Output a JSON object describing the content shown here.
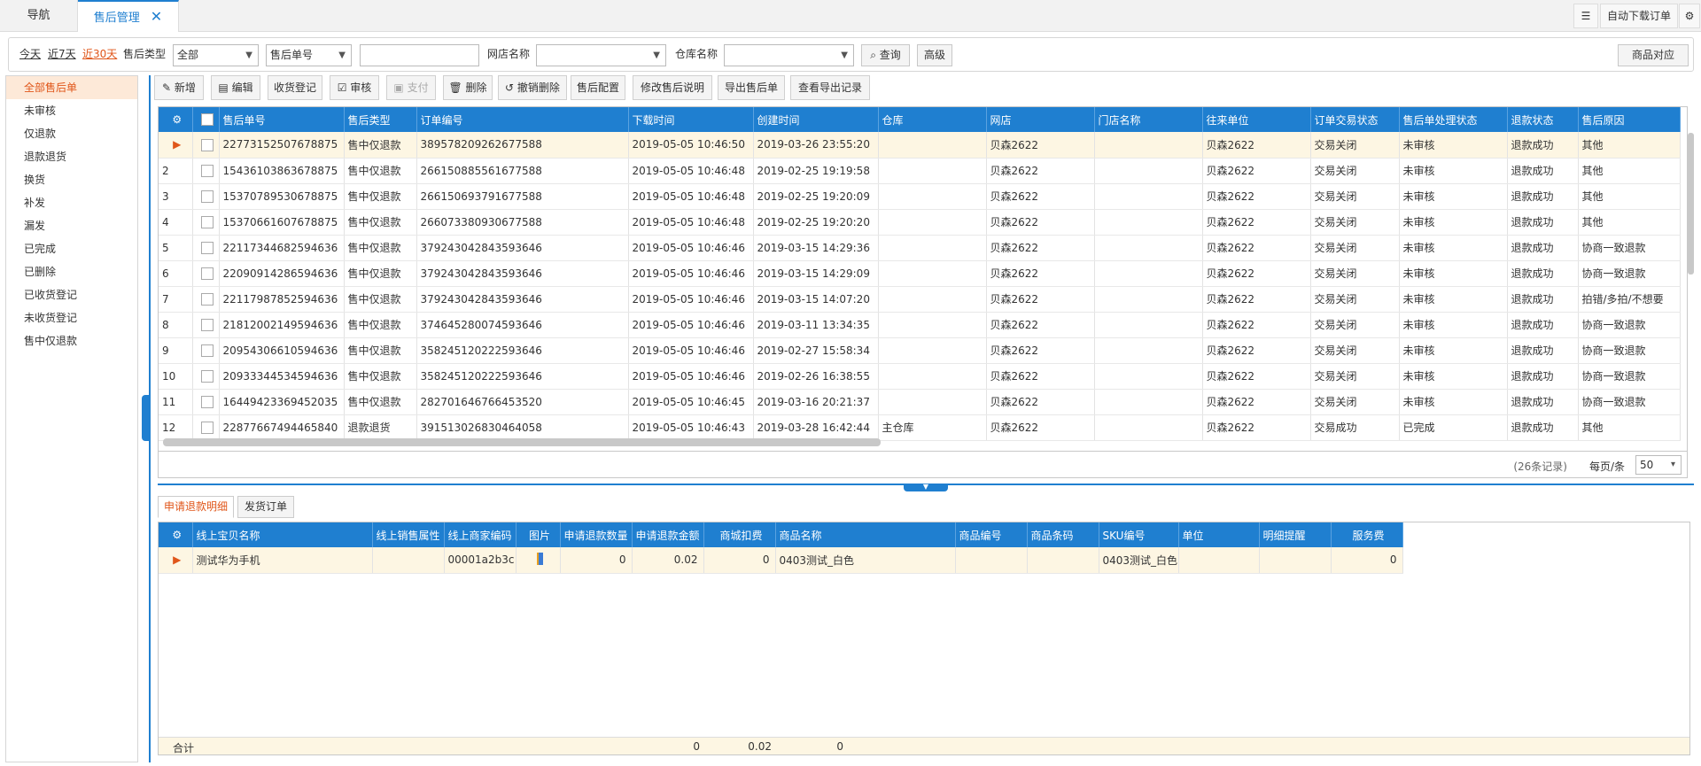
{
  "topbar": {
    "tabs": [
      {
        "label": "导航"
      },
      {
        "label": "售后管理"
      }
    ],
    "auto_download": "自动下载订单"
  },
  "filter": {
    "today": "今天",
    "last7": "近7天",
    "last30": "近30天",
    "type_label": "售后类型",
    "type_value": "全部",
    "field_select": "售后单号",
    "search_value": "",
    "shop_label": "网店名称",
    "shop_value": "",
    "warehouse_label": "仓库名称",
    "warehouse_value": "",
    "query_btn": "查询",
    "advanced_btn": "高级",
    "goods_map_btn": "商品对应"
  },
  "sidebar": {
    "items": [
      {
        "label": "全部售后单"
      },
      {
        "label": "未审核"
      },
      {
        "label": "仅退款"
      },
      {
        "label": "退款退货"
      },
      {
        "label": "换货"
      },
      {
        "label": "补发"
      },
      {
        "label": "漏发"
      },
      {
        "label": "已完成"
      },
      {
        "label": "已删除"
      },
      {
        "label": "已收货登记"
      },
      {
        "label": "未收货登记"
      },
      {
        "label": "售中仅退款"
      }
    ]
  },
  "toolbar": {
    "new": "新增",
    "edit": "编辑",
    "receive": "收货登记",
    "audit": "审核",
    "pay": "支付",
    "delete": "删除",
    "undo_delete": "撤销删除",
    "config": "售后配置",
    "modify_desc": "修改售后说明",
    "export": "导出售后单",
    "view_export": "查看导出记录"
  },
  "main_table": {
    "columns": [
      "售后单号",
      "售后类型",
      "订单编号",
      "下载时间",
      "创建时间",
      "仓库",
      "网店",
      "门店名称",
      "往来单位",
      "订单交易状态",
      "售后单处理状态",
      "退款状态",
      "售后原因"
    ],
    "rows": [
      {
        "no": "▶",
        "id": "22773152507678875",
        "type": "售中仅退款",
        "order": "389578209262677588",
        "dl": "2019-05-05 10:46:50",
        "created": "2019-03-26 23:55:20",
        "wh": "",
        "shop": "贝森2622",
        "store": "",
        "unit": "贝森2622",
        "trade": "交易关闭",
        "proc": "未审核",
        "refund": "退款成功",
        "reason": "其他"
      },
      {
        "no": "2",
        "id": "15436103863678875",
        "type": "售中仅退款",
        "order": "266150885561677588",
        "dl": "2019-05-05 10:46:48",
        "created": "2019-02-25 19:19:58",
        "wh": "",
        "shop": "贝森2622",
        "store": "",
        "unit": "贝森2622",
        "trade": "交易关闭",
        "proc": "未审核",
        "refund": "退款成功",
        "reason": "其他"
      },
      {
        "no": "3",
        "id": "15370789530678875",
        "type": "售中仅退款",
        "order": "266150693791677588",
        "dl": "2019-05-05 10:46:48",
        "created": "2019-02-25 19:20:09",
        "wh": "",
        "shop": "贝森2622",
        "store": "",
        "unit": "贝森2622",
        "trade": "交易关闭",
        "proc": "未审核",
        "refund": "退款成功",
        "reason": "其他"
      },
      {
        "no": "4",
        "id": "15370661607678875",
        "type": "售中仅退款",
        "order": "266073380930677588",
        "dl": "2019-05-05 10:46:48",
        "created": "2019-02-25 19:20:20",
        "wh": "",
        "shop": "贝森2622",
        "store": "",
        "unit": "贝森2622",
        "trade": "交易关闭",
        "proc": "未审核",
        "refund": "退款成功",
        "reason": "其他"
      },
      {
        "no": "5",
        "id": "22117344682594636",
        "type": "售中仅退款",
        "order": "379243042843593646",
        "dl": "2019-05-05 10:46:46",
        "created": "2019-03-15 14:29:36",
        "wh": "",
        "shop": "贝森2622",
        "store": "",
        "unit": "贝森2622",
        "trade": "交易关闭",
        "proc": "未审核",
        "refund": "退款成功",
        "reason": "协商一致退款"
      },
      {
        "no": "6",
        "id": "22090914286594636",
        "type": "售中仅退款",
        "order": "379243042843593646",
        "dl": "2019-05-05 10:46:46",
        "created": "2019-03-15 14:29:09",
        "wh": "",
        "shop": "贝森2622",
        "store": "",
        "unit": "贝森2622",
        "trade": "交易关闭",
        "proc": "未审核",
        "refund": "退款成功",
        "reason": "协商一致退款"
      },
      {
        "no": "7",
        "id": "22117987852594636",
        "type": "售中仅退款",
        "order": "379243042843593646",
        "dl": "2019-05-05 10:46:46",
        "created": "2019-03-15 14:07:20",
        "wh": "",
        "shop": "贝森2622",
        "store": "",
        "unit": "贝森2622",
        "trade": "交易关闭",
        "proc": "未审核",
        "refund": "退款成功",
        "reason": "拍错/多拍/不想要"
      },
      {
        "no": "8",
        "id": "21812002149594636",
        "type": "售中仅退款",
        "order": "374645280074593646",
        "dl": "2019-05-05 10:46:46",
        "created": "2019-03-11 13:34:35",
        "wh": "",
        "shop": "贝森2622",
        "store": "",
        "unit": "贝森2622",
        "trade": "交易关闭",
        "proc": "未审核",
        "refund": "退款成功",
        "reason": "协商一致退款"
      },
      {
        "no": "9",
        "id": "20954306610594636",
        "type": "售中仅退款",
        "order": "358245120222593646",
        "dl": "2019-05-05 10:46:46",
        "created": "2019-02-27 15:58:34",
        "wh": "",
        "shop": "贝森2622",
        "store": "",
        "unit": "贝森2622",
        "trade": "交易关闭",
        "proc": "未审核",
        "refund": "退款成功",
        "reason": "协商一致退款"
      },
      {
        "no": "10",
        "id": "20933344534594636",
        "type": "售中仅退款",
        "order": "358245120222593646",
        "dl": "2019-05-05 10:46:46",
        "created": "2019-02-26 16:38:55",
        "wh": "",
        "shop": "贝森2622",
        "store": "",
        "unit": "贝森2622",
        "trade": "交易关闭",
        "proc": "未审核",
        "refund": "退款成功",
        "reason": "协商一致退款"
      },
      {
        "no": "11",
        "id": "16449423369452035",
        "type": "售中仅退款",
        "order": "282701646766453520",
        "dl": "2019-05-05 10:46:45",
        "created": "2019-03-16 20:21:37",
        "wh": "",
        "shop": "贝森2622",
        "store": "",
        "unit": "贝森2622",
        "trade": "交易关闭",
        "proc": "未审核",
        "refund": "退款成功",
        "reason": "协商一致退款"
      },
      {
        "no": "12",
        "id": "22877667494465840",
        "type": "退款退货",
        "order": "391513026830464058",
        "dl": "2019-05-05 10:46:43",
        "created": "2019-03-28 16:42:44",
        "wh": "主仓库",
        "shop": "贝森2622",
        "store": "",
        "unit": "贝森2622",
        "trade": "交易成功",
        "proc": "已完成",
        "refund": "退款成功",
        "reason": "其他"
      }
    ]
  },
  "pager": {
    "records": "(26条记录)",
    "per_page_label": "每页/条",
    "per_page": "50"
  },
  "subtabs": [
    {
      "label": "申请退款明细"
    },
    {
      "label": "发货订单"
    }
  ],
  "detail_table": {
    "columns": [
      "线上宝贝名称",
      "线上销售属性",
      "线上商家编码",
      "图片",
      "申请退款数量",
      "申请退款金额",
      "商城扣费",
      "商品名称",
      "商品编号",
      "商品条码",
      "SKU编号",
      "单位",
      "明细提醒",
      "服务费"
    ],
    "rows": [
      {
        "name": "测试华为手机",
        "attr": "",
        "code": "00001a2b3c",
        "qty": "0",
        "amount": "0.02",
        "fee": "0",
        "goods": "0403测试_白色",
        "gno": "",
        "barcode": "",
        "sku": "0403测试_白色",
        "unit": "",
        "remind": "",
        "service": "0"
      }
    ],
    "total_label": "合计",
    "total_qty": "0",
    "total_amount": "0.02",
    "total_fee": "0"
  },
  "colors": {
    "accent": "#1f7fd0",
    "orange": "#e0561a",
    "selected_row": "#fdf6e3"
  }
}
